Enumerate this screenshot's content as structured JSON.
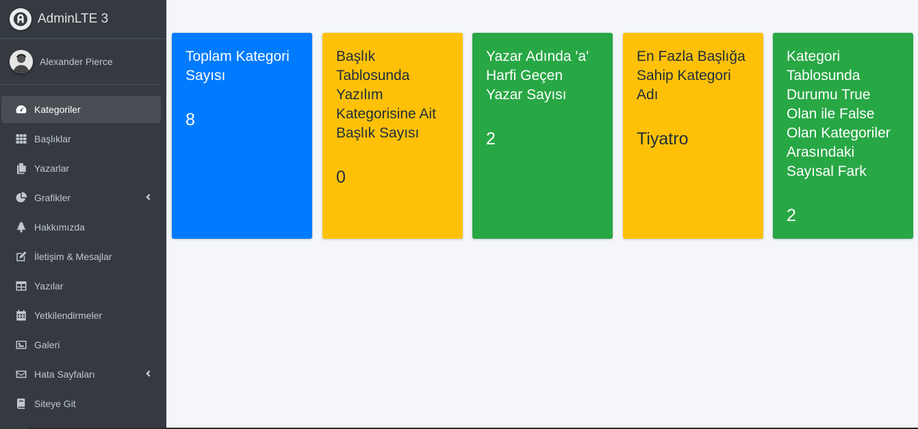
{
  "brand": {
    "name": "AdminLTE 3",
    "logo_icon": "adminlte-logo-icon"
  },
  "user": {
    "name": "Alexander Pierce",
    "avatar_icon": "user-avatar"
  },
  "nav": [
    {
      "label": "Kategoriler",
      "icon": "tachometer-icon",
      "active": true
    },
    {
      "label": "Başlıklar",
      "icon": "grid-icon"
    },
    {
      "label": "Yazarlar",
      "icon": "copy-icon"
    },
    {
      "label": "Grafikler",
      "icon": "chart-pie-icon",
      "chevron": true
    },
    {
      "label": "Hakkımızda",
      "icon": "tree-icon"
    },
    {
      "label": "İletişim & Mesajlar",
      "icon": "edit-icon"
    },
    {
      "label": "Yazılar",
      "icon": "table-icon"
    },
    {
      "label": "Yetkilendirmeler",
      "icon": "calendar-icon"
    },
    {
      "label": "Galeri",
      "icon": "image-icon"
    },
    {
      "label": "Hata Sayfaları",
      "icon": "envelope-icon",
      "chevron": true
    },
    {
      "label": "Siteye Git",
      "icon": "book-icon"
    }
  ],
  "boxes": [
    {
      "title": "Toplam Kategori Sayısı",
      "value": "8",
      "color": "#007bff"
    },
    {
      "title": "Başlık Tablosunda Yazılım Kategorisine Ait Başlık Sayısı",
      "value": "0",
      "color": "#ffc107"
    },
    {
      "title": "Yazar Adında 'a' Harfi Geçen Yazar Sayısı",
      "value": "2",
      "color": "#28a745"
    },
    {
      "title": "En Fazla Başlığa Sahip Kategori Adı",
      "value": "Tiyatro",
      "color": "#ffc107"
    },
    {
      "title": "Kategori Tablosunda Durumu True Olan ile False Olan Kategoriler Arasındaki Sayısal Fark",
      "value": "2",
      "color": "#28a745"
    }
  ]
}
